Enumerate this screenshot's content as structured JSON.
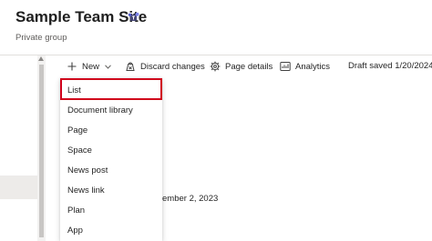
{
  "site": {
    "title": "Sample Team Site",
    "subtitle": "Private group",
    "teams_icon": "teams-icon"
  },
  "toolbar": {
    "new_label": "New",
    "discard_label": "Discard changes",
    "page_details_label": "Page details",
    "analytics_label": "Analytics",
    "draft_status": "Draft saved 1/20/2024",
    "icons": {
      "new": "plus-icon",
      "new_dropdown": "chevron-down-icon",
      "discard": "discard-icon",
      "page_details": "gear-icon",
      "analytics": "analytics-icon"
    }
  },
  "new_menu": {
    "items": [
      {
        "label": "List",
        "highlighted": true
      },
      {
        "label": "Document library"
      },
      {
        "label": "Page"
      },
      {
        "label": "Space"
      },
      {
        "label": "News post"
      },
      {
        "label": "News link"
      },
      {
        "label": "Plan"
      },
      {
        "label": "App"
      }
    ],
    "highlight_color": "#d0021b"
  },
  "background": {
    "date_fragment": "ember 2, 2023"
  }
}
